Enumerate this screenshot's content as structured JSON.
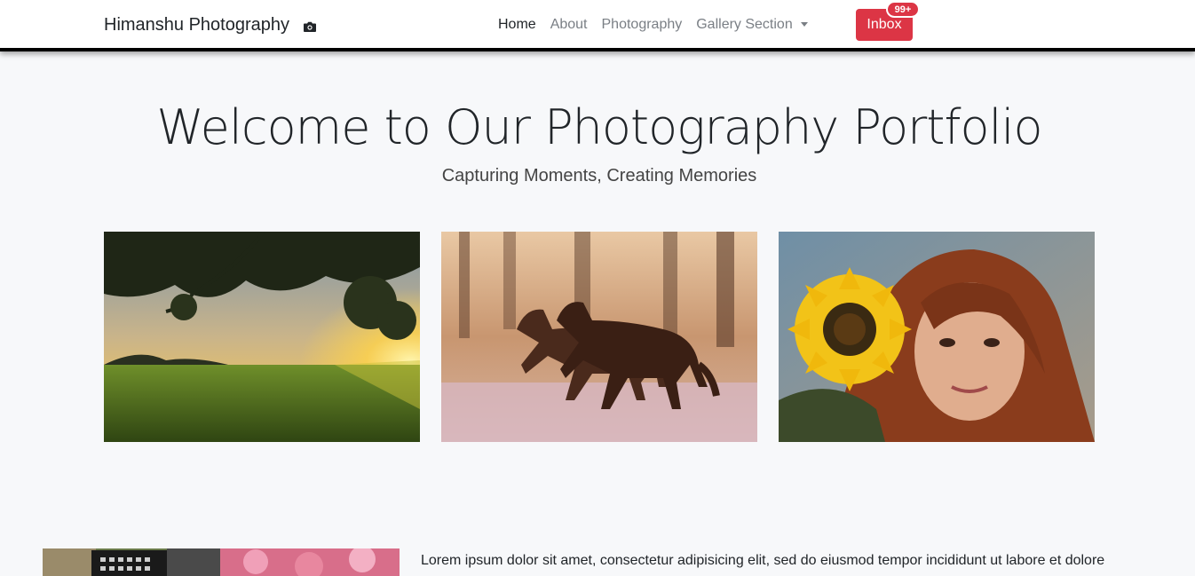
{
  "navbar": {
    "brand": "Himanshu Photography",
    "brand_icon": "camera-icon",
    "links": [
      {
        "label": "Home",
        "active": true
      },
      {
        "label": "About",
        "active": false
      },
      {
        "label": "Photography",
        "active": false
      },
      {
        "label": "Gallery Section",
        "active": false,
        "dropdown": true
      }
    ],
    "inbox_label": "Inbox",
    "inbox_badge": "99+"
  },
  "hero": {
    "title": "Welcome to Our Photography Portfolio",
    "subtitle": "Capturing Moments, Creating Memories"
  },
  "gallery": [
    {
      "subject": "sunset-field"
    },
    {
      "subject": "horses-running"
    },
    {
      "subject": "woman-with-sunflower"
    }
  ],
  "about": {
    "text": "Lorem ipsum dolor sit amet, consectetur adipisicing elit, sed do eiusmod tempor incididunt ut labore et dolore"
  },
  "colors": {
    "accent": "#dc3545",
    "background": "#f7f8fa",
    "navbar_bg": "#ffffff"
  }
}
